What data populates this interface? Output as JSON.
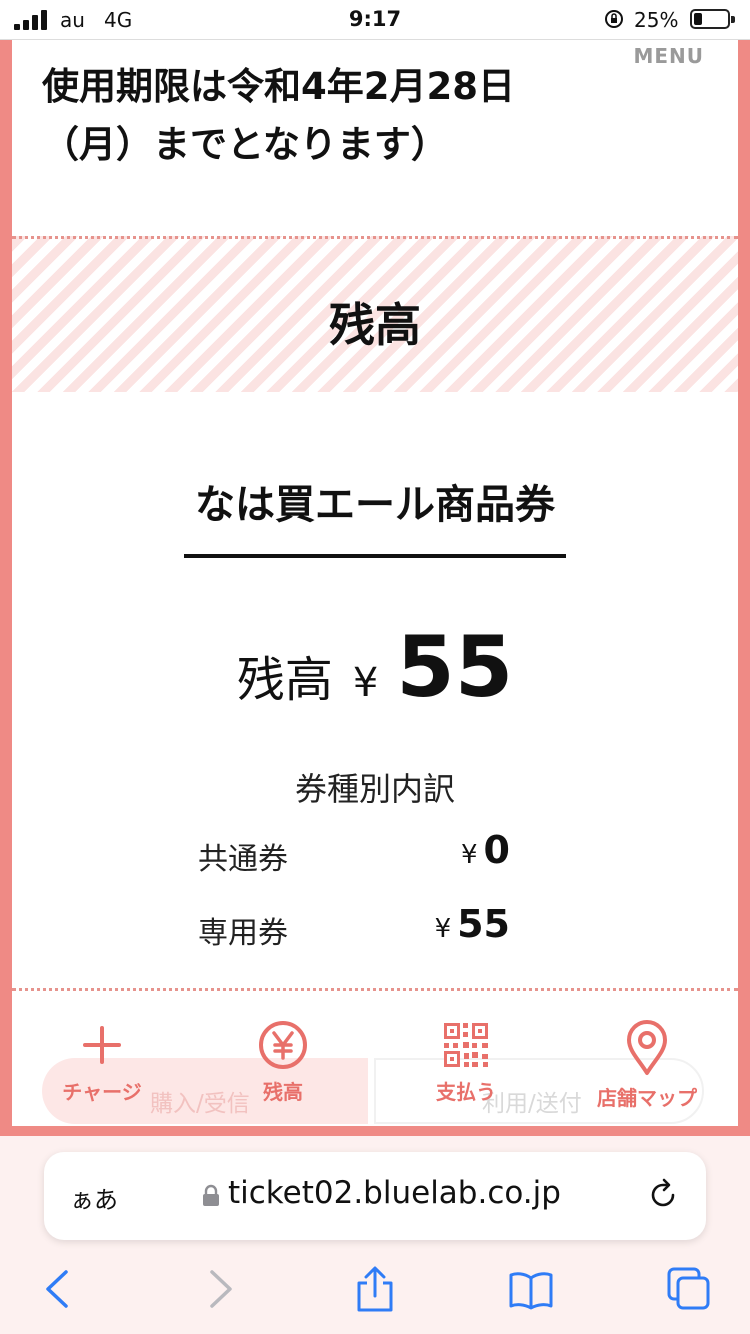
{
  "status_bar": {
    "carrier": "au",
    "network": "4G",
    "time": "9:17",
    "battery_percent": "25%",
    "battery_level": 0.25
  },
  "page": {
    "menu_label": "MENU",
    "notice_line1": "使用期限は令和4年2月28日",
    "notice_line2": "（月）までとなります）",
    "section_title": "残高",
    "product_name": "なは買エール商品券",
    "total": {
      "label": "残高",
      "currency": "¥",
      "amount": "55"
    },
    "breakdown": {
      "title": "券種別内訳",
      "rows": [
        {
          "label": "共通券",
          "currency": "¥",
          "amount": "0"
        },
        {
          "label": "専用券",
          "currency": "¥",
          "amount": "55"
        }
      ]
    }
  },
  "tab_bar": {
    "tabs": [
      {
        "label": "チャージ",
        "icon": "plus-icon"
      },
      {
        "label": "残高",
        "icon": "yen-circle-icon"
      },
      {
        "label": "支払う",
        "icon": "qr-code-icon"
      },
      {
        "label": "店舗マップ",
        "icon": "map-pin-icon"
      }
    ],
    "underlay_left": "購入/受信",
    "underlay_right": "利用/送付"
  },
  "browser": {
    "text_size_button": "ぁあ",
    "url": "ticket02.bluelab.co.jp"
  },
  "colors": {
    "accent": "#ef8a85",
    "tab_icon": "#e8706a",
    "browser_icon": "#2f7cf6"
  }
}
